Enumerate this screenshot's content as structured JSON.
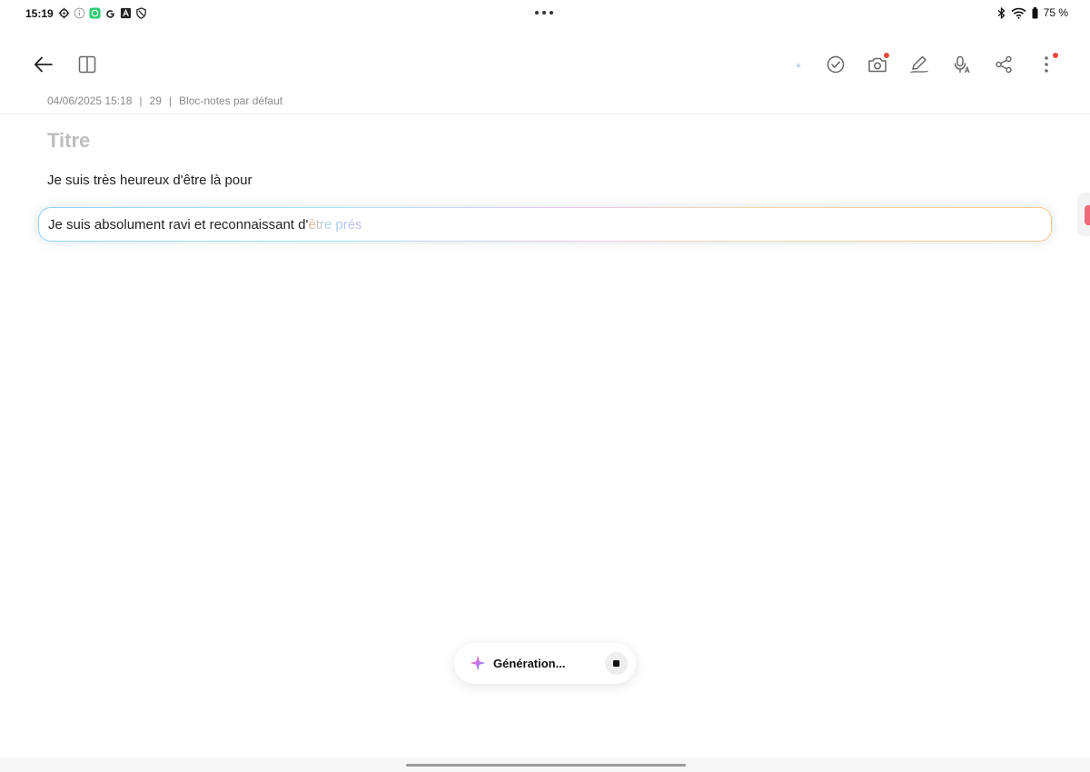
{
  "status_bar": {
    "time": "15:19",
    "left_icons": [
      "settings-icon",
      "info-icon",
      "whatsapp-icon",
      "google-icon",
      "translate-icon",
      "shield-icon"
    ],
    "right_icons": [
      "bluetooth-icon",
      "wifi-icon",
      "battery-icon"
    ],
    "battery": "75 %"
  },
  "toolbar": {
    "left": [
      "back-arrow-icon",
      "split-view-icon"
    ],
    "right": [
      "ai-format-icon",
      "checklist-icon",
      "camera-icon",
      "pen-icon",
      "voice-icon",
      "share-icon",
      "more-icon"
    ]
  },
  "note": {
    "date": "04/06/2025 15:18",
    "char_count": "29",
    "notebook": "Bloc-notes par défaut",
    "title_placeholder": "Titre",
    "body_line": "Je suis très heureux d'être là pour",
    "ai_line_main": "Je suis absolument ravi et reconnaissant d'",
    "ai_line_pending": "être prés"
  },
  "generation": {
    "label": "Génération..."
  },
  "colors": {
    "accent_red": "#e8483b",
    "ai_gradient_start": "#8fd3f5",
    "ai_gradient_end": "#f6c78e",
    "placeholder": "#bdbdbd"
  }
}
